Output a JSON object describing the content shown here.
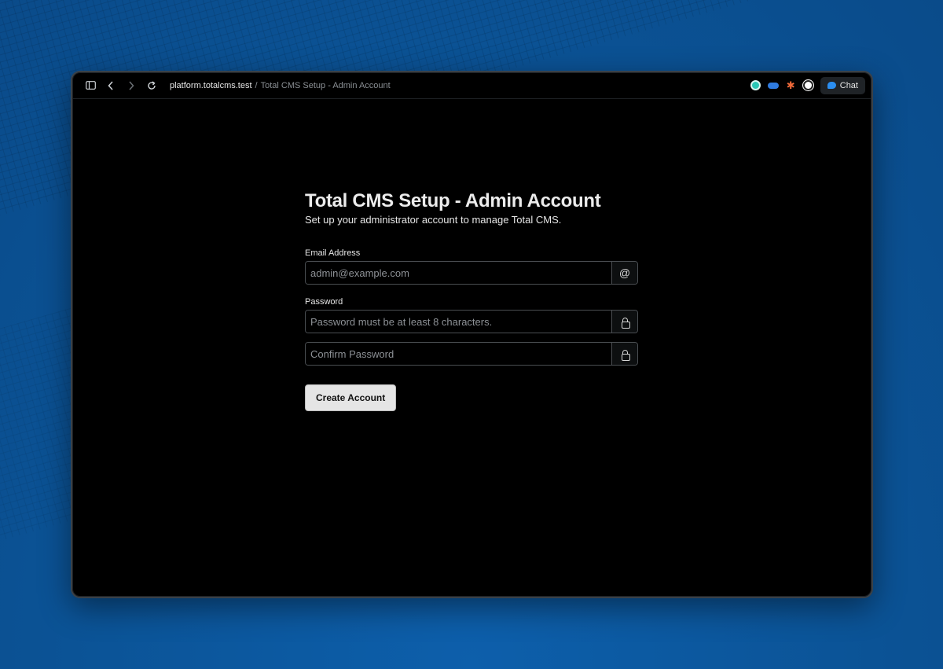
{
  "browser": {
    "host": "platform.totalcms.test",
    "separator": "/",
    "page_title": "Total CMS Setup - Admin Account",
    "chat_label": "Chat"
  },
  "icons": {
    "sidebar": "sidebar-toggle-icon",
    "back": "chevron-left-icon",
    "forward": "chevron-right-icon",
    "reload": "reload-icon",
    "email": "at-icon",
    "password": "lock-icon",
    "confirm": "lock-icon"
  },
  "form": {
    "title": "Total CMS Setup - Admin Account",
    "subtitle": "Set up your administrator account to manage Total CMS.",
    "email_label": "Email Address",
    "email_placeholder": "admin@example.com",
    "email_value": "",
    "password_label": "Password",
    "password_placeholder": "Password must be at least 8 characters.",
    "password_value": "",
    "confirm_placeholder": "Confirm Password",
    "confirm_value": "",
    "submit_label": "Create Account"
  },
  "colors": {
    "desktop": "#0c5aa3",
    "window": "#000000",
    "button": "#e5e5e5",
    "chat_accent": "#2b8ef0"
  }
}
